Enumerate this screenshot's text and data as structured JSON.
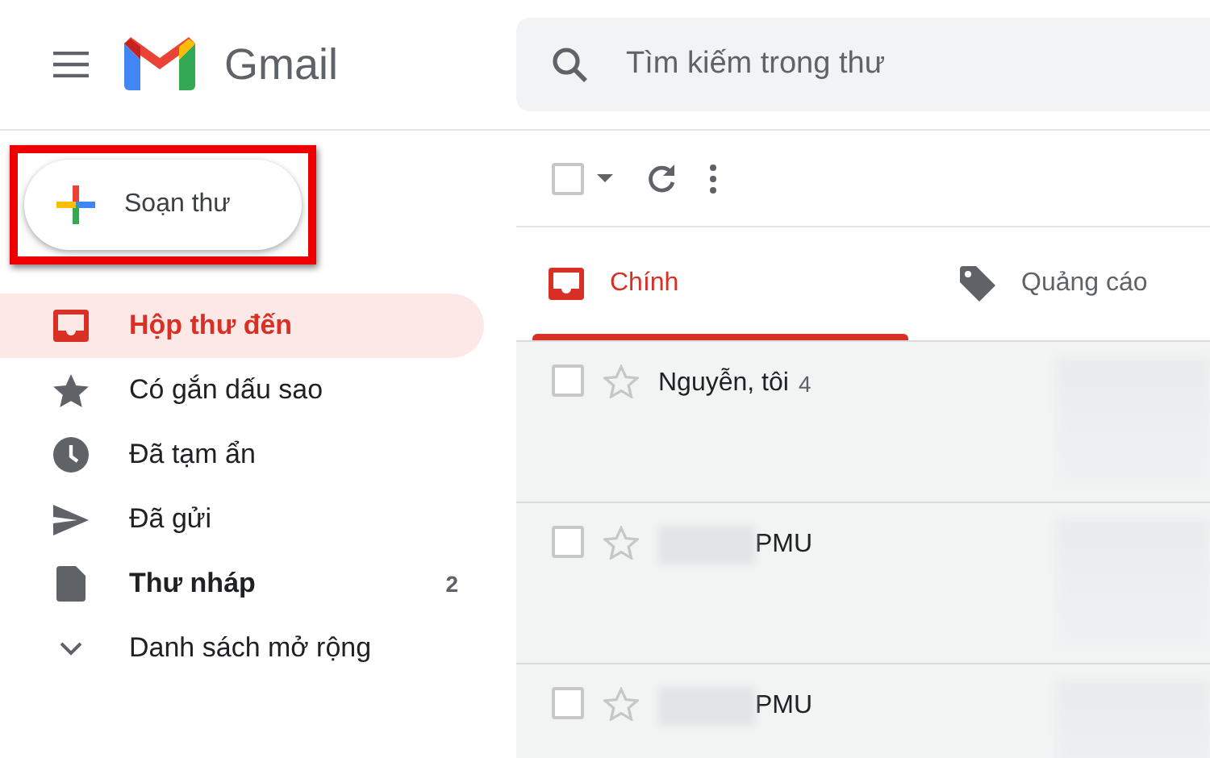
{
  "header": {
    "app_name": "Gmail",
    "search_placeholder": "Tìm kiếm trong thư"
  },
  "compose": {
    "label": "Soạn thư",
    "highlighted": true
  },
  "sidebar": {
    "items": [
      {
        "kind": "inbox",
        "label": "Hộp thư đến",
        "selected": true,
        "bold": true
      },
      {
        "kind": "starred",
        "label": "Có gắn dấu sao",
        "selected": false,
        "bold": false
      },
      {
        "kind": "snoozed",
        "label": "Đã tạm ẩn",
        "selected": false,
        "bold": false
      },
      {
        "kind": "sent",
        "label": "Đã gửi",
        "selected": false,
        "bold": false
      },
      {
        "kind": "drafts",
        "label": "Thư nháp",
        "selected": false,
        "bold": true,
        "count": "2"
      },
      {
        "kind": "more",
        "label": "Danh sách mở rộng",
        "selected": false,
        "bold": false
      }
    ]
  },
  "toolbar": {
    "select_all_checked": false
  },
  "tabs": [
    {
      "kind": "primary",
      "label": "Chính",
      "selected": true
    },
    {
      "kind": "promotions",
      "label": "Quảng cáo",
      "selected": false
    }
  ],
  "emails": [
    {
      "sender": "Nguyễn, tôi",
      "count": "4",
      "checked": false,
      "starred": false,
      "redacted": false
    },
    {
      "sender": "PMU",
      "checked": false,
      "starred": false,
      "redacted": true
    },
    {
      "sender": "PMU",
      "checked": false,
      "starred": false,
      "redacted": true
    }
  ]
}
